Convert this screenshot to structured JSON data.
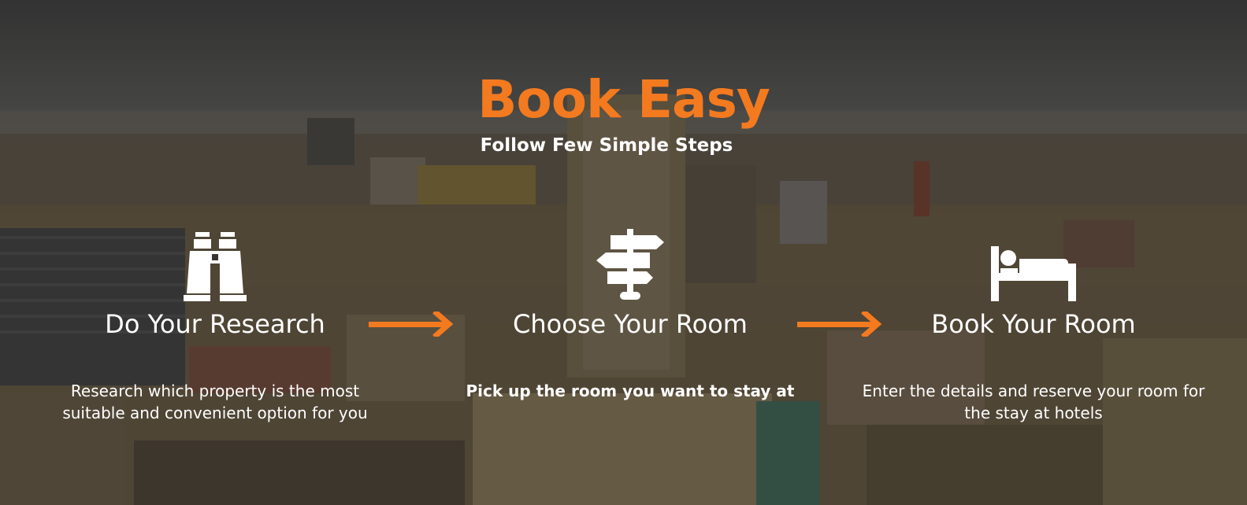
{
  "header": {
    "title": "Book Easy",
    "subtitle": "Follow Few Simple Steps"
  },
  "steps": [
    {
      "icon": "binoculars-icon",
      "title": "Do Your Research",
      "description": "Research which property is the most suitable and convenient option for you"
    },
    {
      "icon": "signpost-icon",
      "title": "Choose Your Room",
      "description": "Pick up the room you want to stay at"
    },
    {
      "icon": "bed-icon",
      "title": "Book Your Room",
      "description": "Enter the details and reserve your room for the stay at hotels"
    }
  ],
  "colors": {
    "accent": "#f47a1f",
    "text": "#ffffff",
    "overlay": "#141210"
  }
}
